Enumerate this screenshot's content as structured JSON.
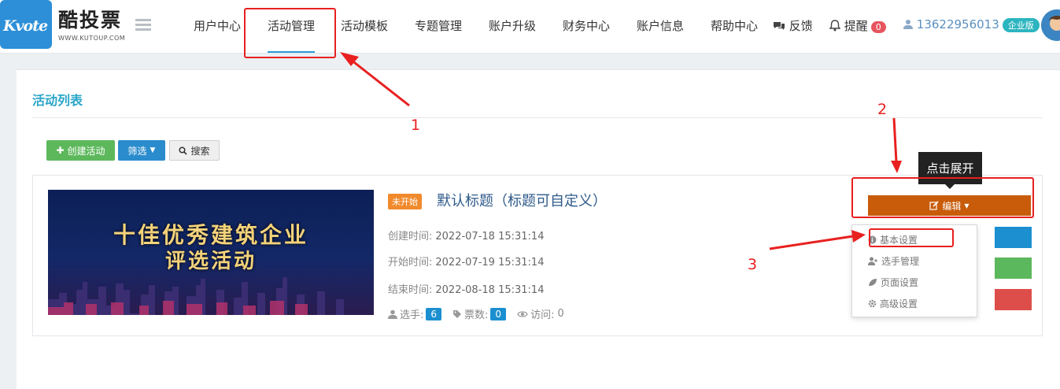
{
  "brand": {
    "logo_text": "Kvote",
    "name": "酷投票",
    "url_text": "WWW.KUTOUP.COM"
  },
  "nav": {
    "items": [
      "用户中心",
      "活动管理",
      "活动模板",
      "专题管理",
      "账户升级",
      "财务中心",
      "账户信息",
      "帮助中心"
    ],
    "active": "活动管理",
    "feedback": "反馈",
    "reminder": "提醒",
    "reminder_count": "0",
    "phone": "13622956013",
    "edition": "企业版"
  },
  "panel": {
    "title": "活动列表",
    "create_button": "创建活动",
    "filter_button": "筛选",
    "search_button": "搜索"
  },
  "activity": {
    "banner_line1": "十佳优秀建筑企业",
    "banner_line2": "评选活动",
    "status": "未开始",
    "title": "默认标题（标题可自定义）",
    "created_label": "创建时间:",
    "created": "2022-07-18 15:31:14",
    "start_label": "开始时间:",
    "start": "2022-07-19 15:31:14",
    "end_label": "结束时间:",
    "end": "2022-08-18 15:31:14",
    "players_label": "选手:",
    "players": "6",
    "votes_label": "票数:",
    "votes": "0",
    "visits_label": "访问:",
    "visits": "0"
  },
  "edit_menu": {
    "button": "编辑",
    "items": [
      "基本设置",
      "选手管理",
      "页面设置",
      "高级设置"
    ]
  },
  "tooltip": "点击展开",
  "annotations": [
    "1",
    "2",
    "3"
  ],
  "colors": {
    "accent": "#2a9bd8",
    "title": "#2aa6c8",
    "green": "#5db85c",
    "blue": "#2a8ccd",
    "orange": "#c85c0b",
    "red_annotation": "#e8201f"
  }
}
